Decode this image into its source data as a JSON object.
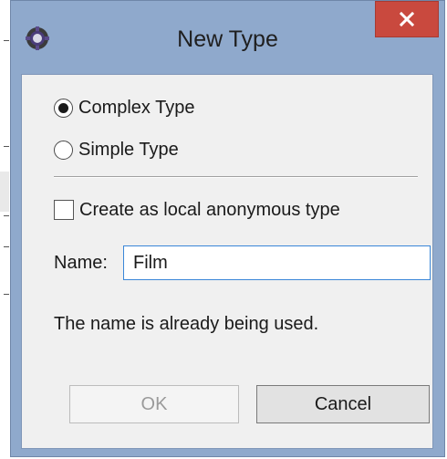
{
  "window": {
    "title": "New Type"
  },
  "type_options": [
    {
      "label": "Complex Type",
      "checked": true
    },
    {
      "label": "Simple Type",
      "checked": false
    }
  ],
  "anonymous_checkbox": {
    "label": "Create as local anonymous type",
    "checked": false
  },
  "name_field": {
    "label": "Name:",
    "value": "Film"
  },
  "status_message": "The name is already being used.",
  "buttons": {
    "ok_label": "OK",
    "ok_enabled": false,
    "cancel_label": "Cancel"
  },
  "colors": {
    "close_button": "#c9493e",
    "window_frame": "#8fa9cc",
    "input_focus_border": "#3a86d8"
  },
  "icons": {
    "app_icon": "eclipse-gear-icon",
    "close_icon": "close-icon"
  }
}
